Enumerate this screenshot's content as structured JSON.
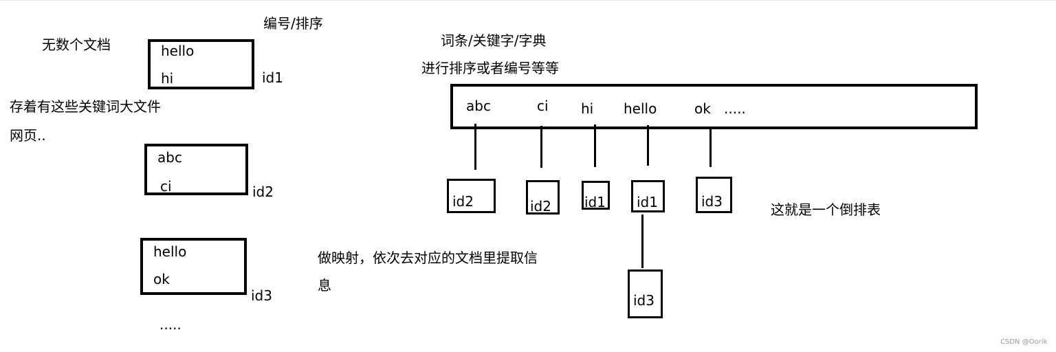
{
  "labels": {
    "numbering_sorting": "编号/排序",
    "countless_docs": "无数个文档",
    "big_files_line1": "存着有这些关键词大文件",
    "big_files_line2": "网页..",
    "dict_title": "词条/关键字/字典",
    "dict_subtitle": "进行排序或者编号等等",
    "mapping_line1": "做映射，依次去对应的文档里提取信",
    "mapping_line2": "息",
    "inverted_index": "这就是一个倒排表",
    "more_docs": ".....",
    "watermark": "CSDN @Oorik"
  },
  "documents": [
    {
      "id": "id1",
      "words": [
        "hello",
        "hi"
      ]
    },
    {
      "id": "id2",
      "words": [
        "abc",
        "ci"
      ]
    },
    {
      "id": "id3",
      "words": [
        "hello",
        "ok"
      ]
    }
  ],
  "dictionary": {
    "terms": [
      "abc",
      "ci",
      "hi",
      "hello",
      "ok"
    ],
    "ellipsis": "....."
  },
  "postings": [
    {
      "term": "abc",
      "ids": [
        "id2"
      ]
    },
    {
      "term": "ci",
      "ids": [
        "id2"
      ]
    },
    {
      "term": "hi",
      "ids": [
        "id1"
      ]
    },
    {
      "term": "hello",
      "ids": [
        "id1",
        "id3"
      ]
    },
    {
      "term": "ok",
      "ids": [
        "id3"
      ]
    }
  ]
}
